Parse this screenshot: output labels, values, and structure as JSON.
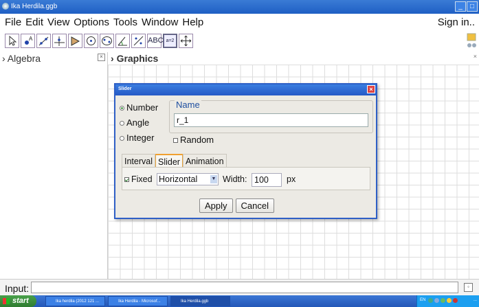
{
  "window": {
    "title": "Ika Herdila.ggb",
    "min": "_",
    "max": "□"
  },
  "menu": {
    "items": [
      "File",
      "Edit",
      "View",
      "Options",
      "Tools",
      "Window",
      "Help"
    ],
    "sign_in": "Sign in.."
  },
  "toolbar": {
    "text_tool": "ABC",
    "slider_tool": "a=2"
  },
  "panels": {
    "algebra": "Algebra",
    "graphics": "Graphics"
  },
  "dialog": {
    "title": "Slider",
    "types": [
      "Number",
      "Angle",
      "Integer"
    ],
    "selected_type": "Number",
    "name_legend": "Name",
    "name_value": "r_1",
    "random_label": "Random",
    "tabs": [
      "Interval",
      "Slider",
      "Animation"
    ],
    "selected_tab": "Slider",
    "fixed_label": "Fixed",
    "orientation": "Horizontal",
    "width_label": "Width:",
    "width_value": "100",
    "width_unit": "px",
    "apply": "Apply",
    "cancel": "Cancel"
  },
  "input": {
    "label": "Input:",
    "value": ""
  },
  "taskbar": {
    "start": "start",
    "tasks": [
      "Ika herdila (2012 121 ...",
      "Ika Herdila - Microsof...",
      "Ika Herdila.ggb"
    ],
    "lang": "EN"
  }
}
